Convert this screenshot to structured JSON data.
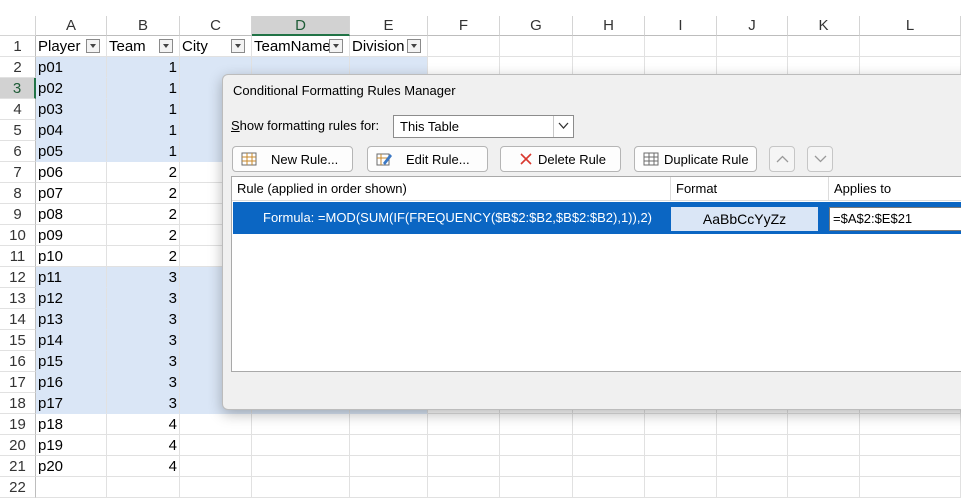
{
  "columns": [
    "A",
    "B",
    "C",
    "D",
    "E",
    "F",
    "G",
    "H",
    "I",
    "J",
    "K",
    "L"
  ],
  "selected_column": "D",
  "selected_row": 3,
  "row_numbers": [
    "1",
    "2",
    "3",
    "4",
    "5",
    "6",
    "7",
    "8",
    "9",
    "10",
    "11",
    "12",
    "13",
    "14",
    "15",
    "16",
    "17",
    "18",
    "19",
    "20",
    "21",
    "22"
  ],
  "table_headers": [
    "Player",
    "Team",
    "City",
    "TeamName",
    "Division"
  ],
  "rows": [
    {
      "player": "p01",
      "team": "1"
    },
    {
      "player": "p02",
      "team": "1"
    },
    {
      "player": "p03",
      "team": "1"
    },
    {
      "player": "p04",
      "team": "1"
    },
    {
      "player": "p05",
      "team": "1"
    },
    {
      "player": "p06",
      "team": "2"
    },
    {
      "player": "p07",
      "team": "2"
    },
    {
      "player": "p08",
      "team": "2"
    },
    {
      "player": "p09",
      "team": "2"
    },
    {
      "player": "p10",
      "team": "2"
    },
    {
      "player": "p11",
      "team": "3"
    },
    {
      "player": "p12",
      "team": "3"
    },
    {
      "player": "p13",
      "team": "3"
    },
    {
      "player": "p14",
      "team": "3"
    },
    {
      "player": "p15",
      "team": "3"
    },
    {
      "player": "p16",
      "team": "3"
    },
    {
      "player": "p17",
      "team": "3"
    },
    {
      "player": "p18",
      "team": "4"
    },
    {
      "player": "p19",
      "team": "4"
    },
    {
      "player": "p20",
      "team": "4"
    }
  ],
  "band_color": "#dae6f6",
  "dialog": {
    "title": "Conditional Formatting Rules Manager",
    "show_rules_for_label": "Show formatting rules for:",
    "show_rules_for_value": "This Table",
    "buttons": {
      "new_rule": "New Rule...",
      "edit_rule": "Edit Rule...",
      "delete_rule": "Delete Rule",
      "duplicate_rule": "Duplicate Rule"
    },
    "list_headers": {
      "rule": "Rule (applied in order shown)",
      "format": "Format",
      "applies_to": "Applies to"
    },
    "rules": [
      {
        "formula": "Formula: =MOD(SUM(IF(FREQUENCY($B$2:$B2,$B$2:$B2),1)),2)",
        "format_preview": "AaBbCcYyZz",
        "applies_to": "=$A$2:$E$21"
      }
    ],
    "selection_color": "#0b66c3"
  }
}
